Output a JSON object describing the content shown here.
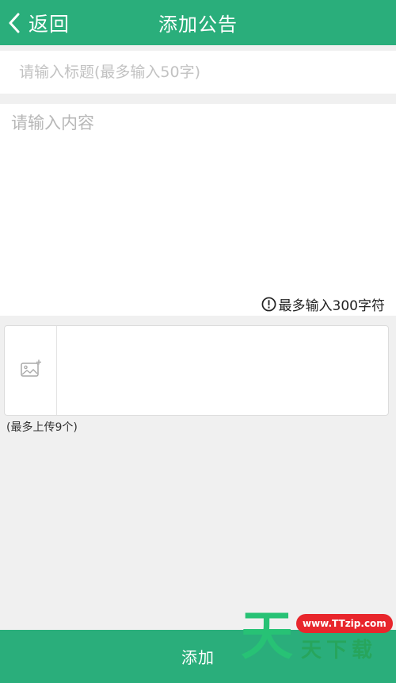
{
  "header": {
    "back_label": "返回",
    "title": "添加公告",
    "back_icon": "chevron-left-icon"
  },
  "form": {
    "title_placeholder": "请输入标题(最多输入50字)",
    "title_value": "",
    "content_placeholder": "请输入内容",
    "content_value": "",
    "limit_hint": "最多输入300字符",
    "limit_icon": "exclamation-circle-icon"
  },
  "upload": {
    "hint": "(最多上传9个)",
    "add_image_icon": "add-image-icon"
  },
  "footer": {
    "submit_label": "添加"
  },
  "watermark": {
    "big_char": "天",
    "url": "www.TTzip.com",
    "text": "天下载"
  },
  "colors": {
    "primary": "#2aae7b",
    "background": "#f0f0f0",
    "watermark_green": "#27c275",
    "watermark_red": "#e8262c"
  }
}
